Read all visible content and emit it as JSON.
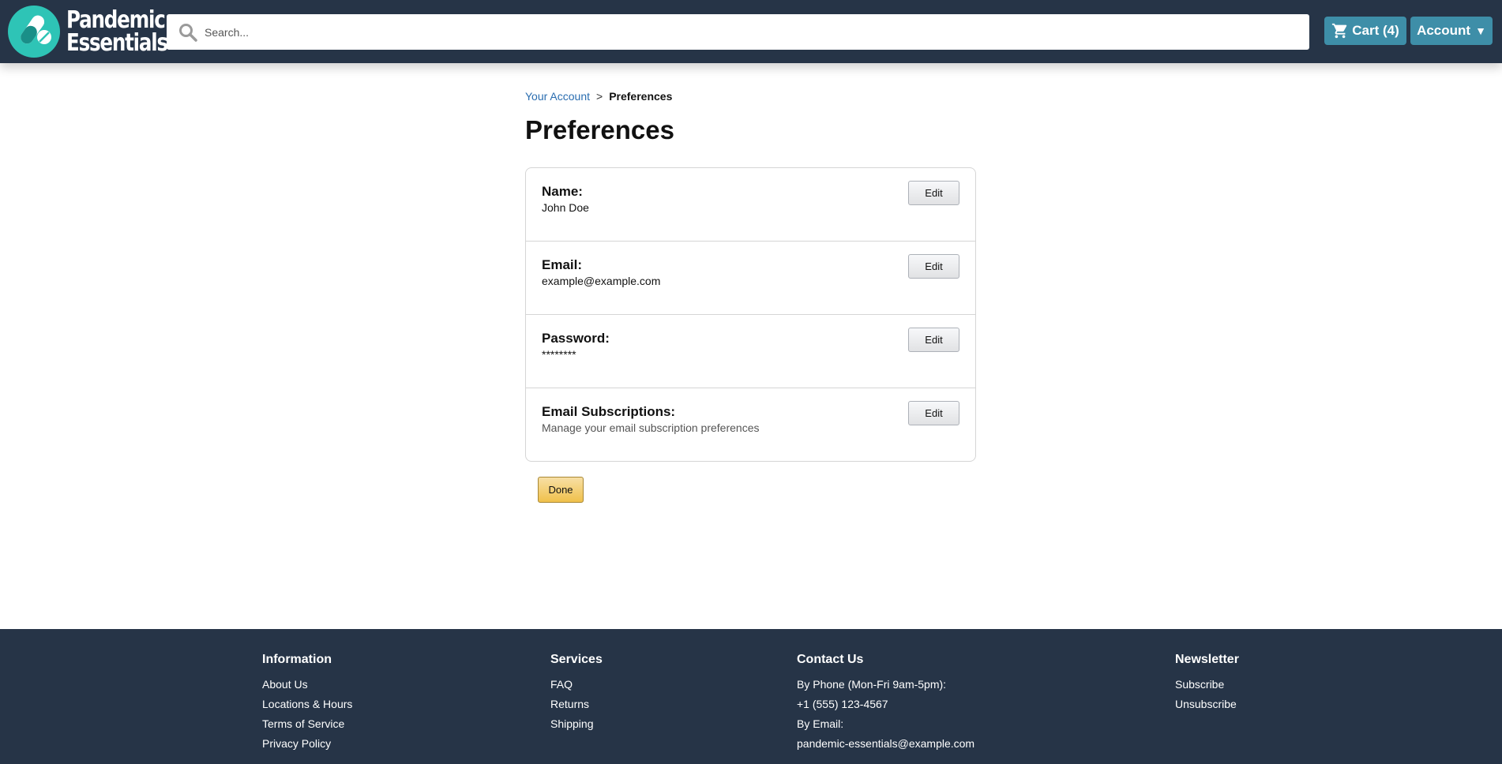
{
  "header": {
    "logo_line1": "Pandemic",
    "logo_line2": "Essentials",
    "search_placeholder": "Search...",
    "cart_label": "Cart (4)",
    "account_label": "Account",
    "account_caret": "▼",
    "colors": {
      "bar": "#263447",
      "button": "#3e8ea8",
      "logo": "#2ec4b6"
    }
  },
  "breadcrumb": {
    "parent": "Your Account",
    "separator": ">",
    "current": "Preferences"
  },
  "page_title": "Preferences",
  "preferences": [
    {
      "label": "Name:",
      "value": "John Doe",
      "button": "Edit"
    },
    {
      "label": "Email:",
      "value": "example@example.com",
      "button": "Edit"
    },
    {
      "label": "Password:",
      "value": "********",
      "button": "Edit"
    },
    {
      "label": "Email Subscriptions:",
      "value": "Manage your email subscription preferences",
      "button": "Edit"
    }
  ],
  "done_label": "Done",
  "footer": {
    "information": {
      "title": "Information",
      "items": [
        "About Us",
        "Locations & Hours",
        "Terms of Service",
        "Privacy Policy"
      ]
    },
    "services": {
      "title": "Services",
      "items": [
        "FAQ",
        "Returns",
        "Shipping"
      ]
    },
    "contact": {
      "title": "Contact Us",
      "items": [
        "By Phone (Mon-Fri 9am-5pm):",
        "+1 (555) 123-4567",
        "By Email:",
        "pandemic-essentials@example.com"
      ]
    },
    "newsletter": {
      "title": "Newsletter",
      "items": [
        "Subscribe",
        "Unsubscribe"
      ]
    }
  }
}
